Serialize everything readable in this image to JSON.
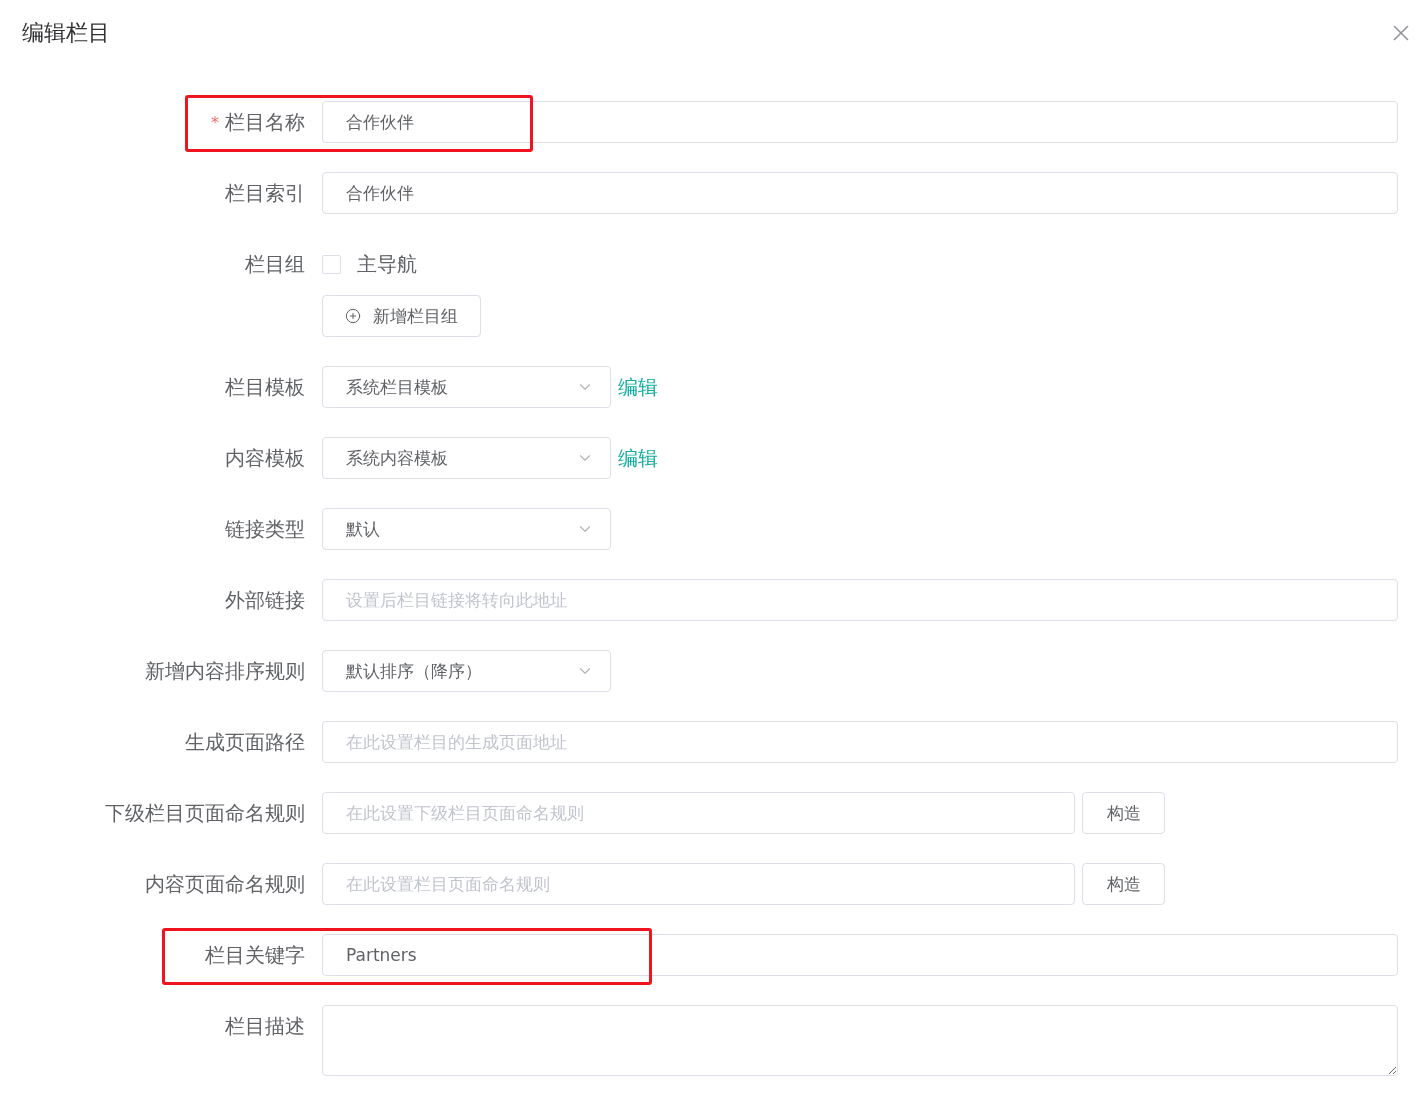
{
  "dialog": {
    "title": "编辑栏目"
  },
  "rows": [
    {
      "kind": "input",
      "label": "栏目名称",
      "required": true,
      "required_mark": "*",
      "highlighted": true,
      "value": "合作伙伴"
    },
    {
      "kind": "input",
      "label": "栏目索引",
      "required": false,
      "highlighted": false,
      "value": "合作伙伴"
    },
    {
      "kind": "checkbox_group",
      "label": "栏目组",
      "required": false,
      "highlighted": false,
      "options": [
        {
          "label": "主导航",
          "checked": false
        }
      ],
      "button": "新增栏目组"
    },
    {
      "kind": "select",
      "label": "栏目模板",
      "required": false,
      "highlighted": false,
      "value": "系统栏目模板",
      "link": "编辑"
    },
    {
      "kind": "select",
      "label": "内容模板",
      "required": false,
      "highlighted": false,
      "value": "系统内容模板",
      "link": "编辑"
    },
    {
      "kind": "select",
      "label": "链接类型",
      "required": false,
      "highlighted": false,
      "value": "默认"
    },
    {
      "kind": "input",
      "label": "外部链接",
      "required": false,
      "highlighted": false,
      "placeholder": "设置后栏目链接将转向此地址"
    },
    {
      "kind": "select",
      "label": "新增内容排序规则",
      "required": false,
      "highlighted": false,
      "value": "默认排序（降序）"
    },
    {
      "kind": "input",
      "label": "生成页面路径",
      "required": false,
      "highlighted": false,
      "placeholder": "在此设置栏目的生成页面地址"
    },
    {
      "kind": "input_button",
      "label": "下级栏目页面命名规则",
      "required": false,
      "highlighted": false,
      "placeholder": "在此设置下级栏目页面命名规则",
      "button": "构造"
    },
    {
      "kind": "input_button",
      "label": "内容页面命名规则",
      "required": false,
      "highlighted": false,
      "placeholder": "在此设置栏目页面命名规则",
      "button": "构造"
    },
    {
      "kind": "input",
      "label": "栏目关键字",
      "required": false,
      "highlighted": true,
      "value": "Partners"
    },
    {
      "kind": "textarea",
      "label": "栏目描述",
      "required": false,
      "highlighted": false
    }
  ]
}
